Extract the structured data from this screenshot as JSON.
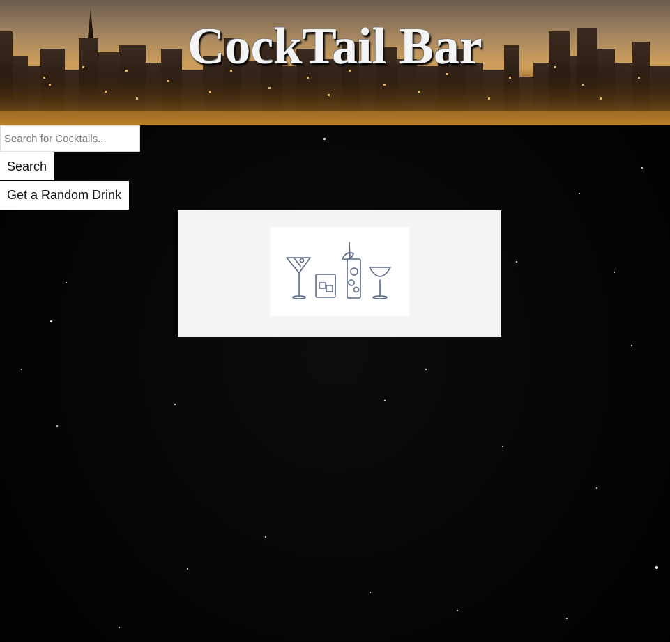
{
  "header": {
    "title": "CockTail Bar"
  },
  "search": {
    "placeholder": "Search for Cocktails...",
    "value": ""
  },
  "buttons": {
    "search_label": "Search",
    "random_label": "Get a Random Drink"
  },
  "result_card": {
    "image_icon": "cocktail-glasses-illustration"
  },
  "colors": {
    "background": "#050505",
    "card_background": "#f4f4f4",
    "button_background": "#ffffff",
    "title_color": "#f4f4f4"
  }
}
